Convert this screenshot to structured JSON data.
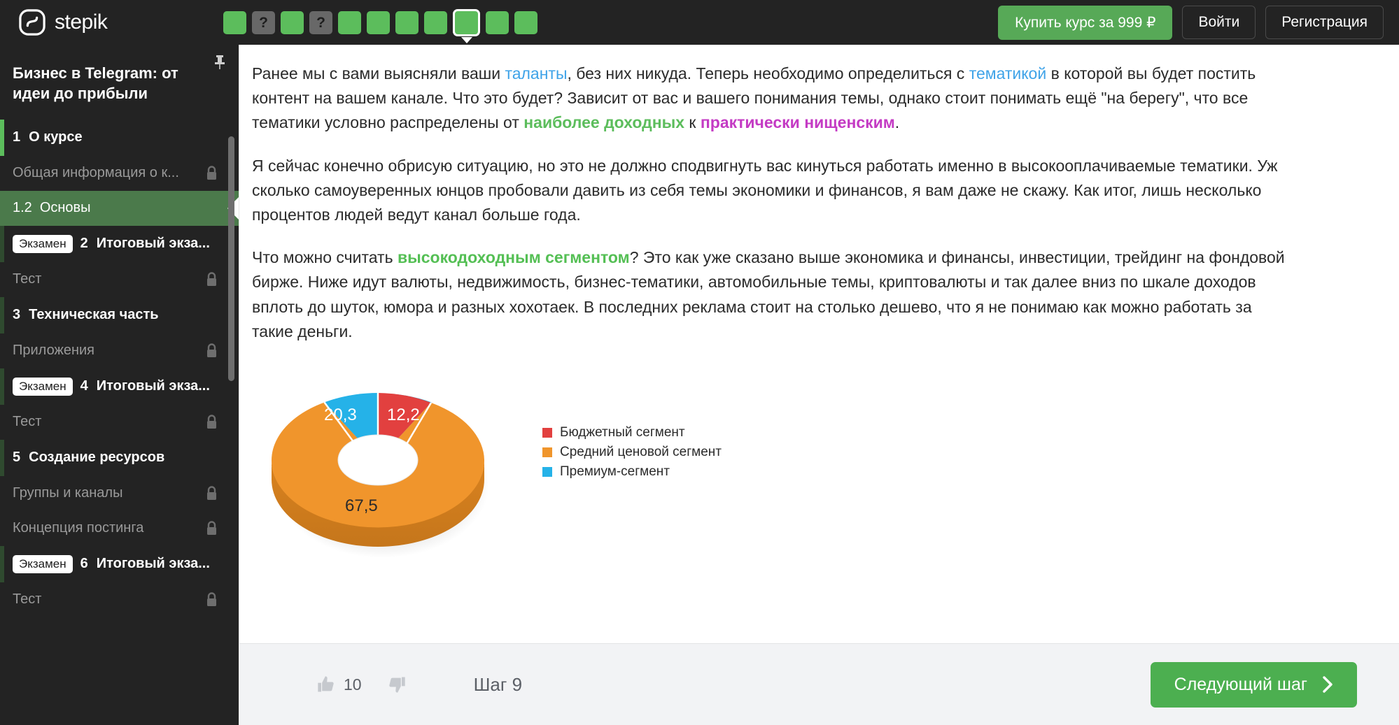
{
  "header": {
    "logo_text": "stepik",
    "logo_icon": "stepik-logo-icon",
    "progress_items": [
      {
        "type": "done",
        "label": ""
      },
      {
        "type": "question",
        "label": "?"
      },
      {
        "type": "done",
        "label": ""
      },
      {
        "type": "question",
        "label": "?"
      },
      {
        "type": "done",
        "label": ""
      },
      {
        "type": "done",
        "label": ""
      },
      {
        "type": "done",
        "label": ""
      },
      {
        "type": "done",
        "label": ""
      },
      {
        "type": "current",
        "label": ""
      },
      {
        "type": "done",
        "label": ""
      },
      {
        "type": "done",
        "label": ""
      }
    ],
    "buy_button": "Купить курс за 999 ₽",
    "login_button": "Войти",
    "register_button": "Регистрация"
  },
  "sidebar": {
    "pin_icon": "pushpin-icon",
    "course_title": "Бизнес в Telegram: от идеи до прибыли",
    "items": [
      {
        "kind": "section",
        "num": "1",
        "title": "О курсе",
        "badge": "",
        "locked": false,
        "active": false,
        "edge": "#5cbd5c"
      },
      {
        "kind": "lesson",
        "num": "",
        "title": "Общая информация о к...",
        "badge": "",
        "locked": true,
        "active": false,
        "edge": ""
      },
      {
        "kind": "lesson",
        "num": "1.2",
        "title": "Основы",
        "badge": "",
        "locked": false,
        "active": true,
        "edge": ""
      },
      {
        "kind": "section",
        "num": "2",
        "title": "Итоговый экза...",
        "badge": "Экзамен",
        "locked": false,
        "active": false,
        "edge": "#2f4a2f"
      },
      {
        "kind": "lesson",
        "num": "",
        "title": "Тест",
        "badge": "",
        "locked": true,
        "active": false,
        "edge": ""
      },
      {
        "kind": "section",
        "num": "3",
        "title": "Техническая часть",
        "badge": "",
        "locked": false,
        "active": false,
        "edge": "#2f4a2f"
      },
      {
        "kind": "lesson",
        "num": "",
        "title": "Приложения",
        "badge": "",
        "locked": true,
        "active": false,
        "edge": ""
      },
      {
        "kind": "section",
        "num": "4",
        "title": "Итоговый экза...",
        "badge": "Экзамен",
        "locked": false,
        "active": false,
        "edge": "#2f4a2f"
      },
      {
        "kind": "lesson",
        "num": "",
        "title": "Тест",
        "badge": "",
        "locked": true,
        "active": false,
        "edge": ""
      },
      {
        "kind": "section",
        "num": "5",
        "title": "Создание ресурсов",
        "badge": "",
        "locked": false,
        "active": false,
        "edge": "#2f4a2f"
      },
      {
        "kind": "lesson",
        "num": "",
        "title": "Группы и каналы",
        "badge": "",
        "locked": true,
        "active": false,
        "edge": ""
      },
      {
        "kind": "lesson",
        "num": "",
        "title": "Концепция постинга",
        "badge": "",
        "locked": true,
        "active": false,
        "edge": ""
      },
      {
        "kind": "section",
        "num": "6",
        "title": "Итоговый экза...",
        "badge": "Экзамен",
        "locked": false,
        "active": false,
        "edge": "#2f4a2f"
      },
      {
        "kind": "lesson",
        "num": "",
        "title": "Тест",
        "badge": "",
        "locked": true,
        "active": false,
        "edge": ""
      }
    ]
  },
  "lesson": {
    "paragraph1": {
      "t1": "Ранее мы с вами выясняли ваши ",
      "link1": "таланты",
      "t2": ", без них никуда. Теперь необходимо определиться с ",
      "link2": "тематикой",
      "t3": " в которой вы будет постить контент на вашем канале. Что это будет? Зависит от вас и вашего понимания темы, однако стоит понимать ещё \"на берегу\", что все тематики условно распределены от ",
      "hl1": "наиболее доходных",
      "t4": " к ",
      "hl2": "практически нищенским",
      "t5": "."
    },
    "paragraph2": "Я сейчас конечно обрисую ситуацию, но это не должно сподвигнуть вас кинуться работать именно в высокооплачиваемые тематики. Уж сколько самоуверенных юнцов пробовали давить из себя темы экономики и финансов, я вам даже не скажу. Как итог, лишь несколько процентов людей ведут канал больше года.",
    "paragraph3": {
      "t1": "Что можно считать ",
      "hl1": "высокодоходным сегментом",
      "t2": "? Это как уже сказано выше экономика и финансы, инвестиции, трейдинг на фондовой бирже. Ниже идут валюты, недвижимость, бизнес-тематики, автомобильные темы, криптовалюты и так далее вниз по шкале доходов вплоть до шуток, юмора и разных хохотаек. В последних реклама стоит на столько дешево, что я не понимаю как можно работать за такие деньги."
    }
  },
  "chart_data": {
    "type": "pie",
    "title": "",
    "categories": [
      "Бюджетный сегмент",
      "Средний ценовой сегмент",
      "Премиум-сегмент"
    ],
    "values": [
      12.2,
      67.5,
      20.3
    ],
    "value_labels": [
      "12,2",
      "67,5",
      "20,3"
    ],
    "colors": [
      "#e2403f",
      "#f0952c",
      "#25b2e8"
    ],
    "legend_position": "right",
    "donut": true,
    "three_d": true,
    "grid": false
  },
  "footer": {
    "thumb_up_icon": "thumbs-up-icon",
    "thumb_down_icon": "thumbs-down-icon",
    "like_count": "10",
    "step_label": "Шаг 9",
    "next_button": "Следующий шаг",
    "next_icon": "chevron-right-icon"
  }
}
